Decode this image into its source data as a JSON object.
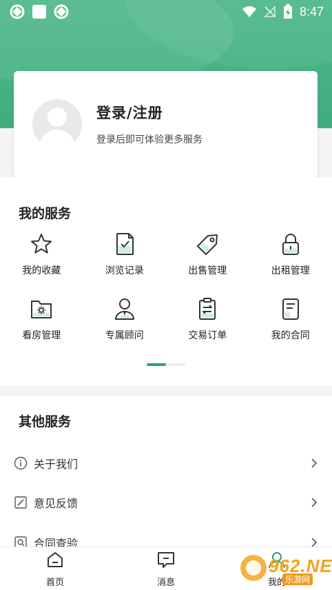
{
  "status_bar": {
    "time": "8:47"
  },
  "profile": {
    "login_title": "登录/注册",
    "login_subtitle": "登录后即可体验更多服务"
  },
  "my_services": {
    "title": "我的服务",
    "items": [
      {
        "label": "我的收藏",
        "icon": "star-icon"
      },
      {
        "label": "浏览记录",
        "icon": "history-icon"
      },
      {
        "label": "出售管理",
        "icon": "tag-icon"
      },
      {
        "label": "出租管理",
        "icon": "lock-icon"
      },
      {
        "label": "看房管理",
        "icon": "folder-gear-icon"
      },
      {
        "label": "专属顾问",
        "icon": "advisor-icon"
      },
      {
        "label": "交易订单",
        "icon": "clipboard-swap-icon"
      },
      {
        "label": "我的合同",
        "icon": "contract-icon"
      }
    ]
  },
  "other_services": {
    "title": "其他服务",
    "items": [
      {
        "label": "关于我们",
        "icon": "info-icon"
      },
      {
        "label": "意见反馈",
        "icon": "edit-icon"
      },
      {
        "label": "合同查验",
        "icon": "search-document-icon"
      }
    ]
  },
  "bottom_nav": {
    "items": [
      {
        "label": "首页",
        "icon": "home-icon"
      },
      {
        "label": "消息",
        "icon": "message-icon"
      },
      {
        "label": "我的",
        "icon": "profile-icon"
      }
    ]
  },
  "watermark": {
    "text": "962.NET",
    "sub": "乐游网"
  },
  "colors": {
    "accent": "#3fae7c",
    "indicator": "#2aa26f"
  }
}
